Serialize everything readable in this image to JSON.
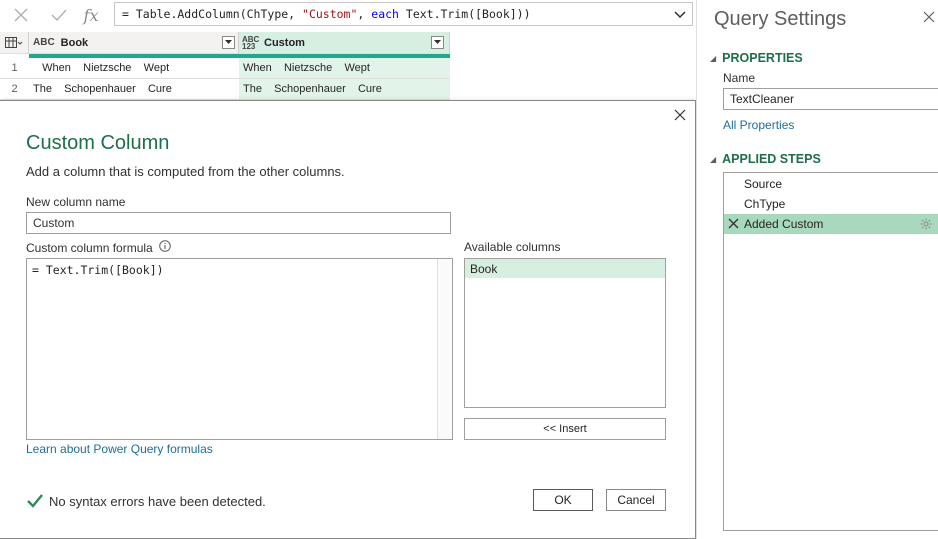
{
  "formula_bar": {
    "prefix": "= Table.AddColumn(ChType, ",
    "string_arg": "\"Custom\"",
    "sep": ", ",
    "keyword": "each",
    "suffix": " Text.Trim([Book]))",
    "icons": {
      "cancel": "close-icon",
      "commit": "check-icon",
      "fx": "fx"
    }
  },
  "grid": {
    "columns": [
      {
        "name": "Book",
        "type_icon": "ABC"
      },
      {
        "name": "Custom",
        "type_icon": "ABC 123"
      }
    ],
    "rows": [
      {
        "num": "1",
        "book": "   When    Nietzsche    Wept",
        "custom": "When    Nietzsche    Wept"
      },
      {
        "num": "2",
        "book": "The    Schopenhauer    Cure",
        "custom": "The    Schopenhauer    Cure"
      }
    ]
  },
  "dialog": {
    "title": "Custom Column",
    "subtitle": "Add a column that is computed from the other columns.",
    "name_label": "New column name",
    "name_value": "Custom",
    "formula_label": "Custom column formula",
    "formula_value": "= Text.Trim([Book])",
    "available_label": "Available columns",
    "available_columns": [
      "Book"
    ],
    "insert_label": "<< Insert",
    "learn_link": "Learn about Power Query formulas",
    "status": "No syntax errors have been detected.",
    "ok_label": "OK",
    "cancel_label": "Cancel",
    "accent": "#1e6e4a"
  },
  "query_settings": {
    "title": "Query Settings",
    "properties_header": "PROPERTIES",
    "name_label": "Name",
    "name_value": "TextCleaner",
    "all_properties_link": "All Properties",
    "steps_header": "APPLIED STEPS",
    "steps": [
      "Source",
      "ChType",
      "Added Custom"
    ],
    "selected_step": "Added Custom"
  },
  "colors": {
    "green_header": "#d7efe0",
    "green_col": "#e2f4e9",
    "teal_bar": "#1fa88e",
    "selected_step": "#a8d9bd"
  }
}
